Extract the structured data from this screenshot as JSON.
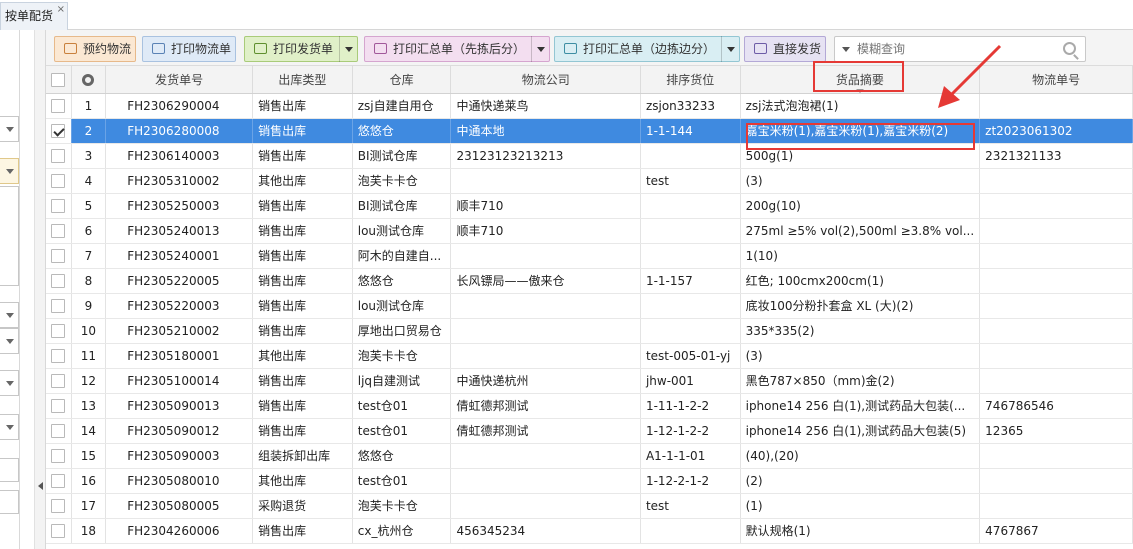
{
  "tab": {
    "label": "按单配货",
    "close": "×"
  },
  "toolbar": {
    "buttons": [
      {
        "label": "预约物流"
      },
      {
        "label": "打印物流单"
      },
      {
        "label": "打印发货单"
      },
      {
        "label": "打印汇总单（先拣后分）"
      },
      {
        "label": "打印汇总单（边拣边分）"
      },
      {
        "label": "直接发货"
      }
    ],
    "search_placeholder": "模糊查询"
  },
  "columns": [
    "发货单号",
    "出库类型",
    "仓库",
    "物流公司",
    "排序货位",
    "货品摘要",
    "物流单号"
  ],
  "rows": [
    {
      "n": "1",
      "checked": false,
      "no": "FH2306290004",
      "type": "销售出库",
      "wh": "zsj自建自用仓",
      "logi": "中通快递莱鸟",
      "loc": "zsjon33233",
      "sum": "zsj法式泡泡裙(1)",
      "track": ""
    },
    {
      "n": "2",
      "checked": true,
      "no": "FH2306280008",
      "type": "销售出库",
      "wh": "悠悠仓",
      "logi": "中通本地",
      "loc": "1-1-144",
      "sum": "嘉宝米粉(1),嘉宝米粉(1),嘉宝米粉(2)",
      "track": "zt2023061302"
    },
    {
      "n": "3",
      "checked": false,
      "no": "FH2306140003",
      "type": "销售出库",
      "wh": "BI测试仓库",
      "logi": "23123123213213",
      "loc": "",
      "sum": "500g(1)",
      "track": "2321321133"
    },
    {
      "n": "4",
      "checked": false,
      "no": "FH2305310002",
      "type": "其他出库",
      "wh": "泡芙卡卡仓",
      "logi": "",
      "loc": "test",
      "sum": "(3)",
      "track": ""
    },
    {
      "n": "5",
      "checked": false,
      "no": "FH2305250003",
      "type": "销售出库",
      "wh": "BI测试仓库",
      "logi": "顺丰710",
      "loc": "",
      "sum": "200g(10)",
      "track": ""
    },
    {
      "n": "6",
      "checked": false,
      "no": "FH2305240013",
      "type": "销售出库",
      "wh": "lou测试仓库",
      "logi": "顺丰710",
      "loc": "",
      "sum": "275ml ≥5% vol(2),500ml ≥3.8% vol...",
      "track": ""
    },
    {
      "n": "7",
      "checked": false,
      "no": "FH2305240001",
      "type": "销售出库",
      "wh": "阿木的自建自...",
      "logi": "",
      "loc": "",
      "sum": "1(10)",
      "track": ""
    },
    {
      "n": "8",
      "checked": false,
      "no": "FH2305220005",
      "type": "销售出库",
      "wh": "悠悠仓",
      "logi": "长风镖局——傲来仓",
      "loc": "1-1-157",
      "sum": "红色; 100cmx200cm(1)",
      "track": ""
    },
    {
      "n": "9",
      "checked": false,
      "no": "FH2305220003",
      "type": "销售出库",
      "wh": "lou测试仓库",
      "logi": "",
      "loc": "",
      "sum": "底妆100分粉扑套盒 XL (大)(2)",
      "track": ""
    },
    {
      "n": "10",
      "checked": false,
      "no": "FH2305210002",
      "type": "销售出库",
      "wh": "厚地出口贸易仓",
      "logi": "",
      "loc": "",
      "sum": "335*335(2)",
      "track": ""
    },
    {
      "n": "11",
      "checked": false,
      "no": "FH2305180001",
      "type": "其他出库",
      "wh": "泡芙卡卡仓",
      "logi": "",
      "loc": "test-005-01-yj",
      "sum": "(3)",
      "track": ""
    },
    {
      "n": "12",
      "checked": false,
      "no": "FH2305100014",
      "type": "销售出库",
      "wh": "ljq自建测试",
      "logi": "中通快递杭州",
      "loc": "jhw-001",
      "sum": "黑色787×850（mm)金(2)",
      "track": ""
    },
    {
      "n": "13",
      "checked": false,
      "no": "FH2305090013",
      "type": "销售出库",
      "wh": "test仓01",
      "logi": "倩虹德邦测试",
      "loc": "1-11-1-2-2",
      "sum": "iphone14 256 白(1),测试药品大包装(...",
      "track": "746786546"
    },
    {
      "n": "14",
      "checked": false,
      "no": "FH2305090012",
      "type": "销售出库",
      "wh": "test仓01",
      "logi": "倩虹德邦测试",
      "loc": "1-12-1-2-2",
      "sum": "iphone14 256 白(1),测试药品大包装(5)",
      "track": "12365"
    },
    {
      "n": "15",
      "checked": false,
      "no": "FH2305090003",
      "type": "组装拆卸出库",
      "wh": "悠悠仓",
      "logi": "",
      "loc": "A1-1-1-01",
      "sum": "(40),(20)",
      "track": ""
    },
    {
      "n": "16",
      "checked": false,
      "no": "FH2305080010",
      "type": "其他出库",
      "wh": "test仓01",
      "logi": "",
      "loc": "1-12-2-1-2",
      "sum": "(2)",
      "track": ""
    },
    {
      "n": "17",
      "checked": false,
      "no": "FH2305080005",
      "type": "采购退货",
      "wh": "泡芙卡卡仓",
      "logi": "",
      "loc": "test",
      "sum": "(1)",
      "track": ""
    },
    {
      "n": "18",
      "checked": false,
      "no": "FH2304260006",
      "type": "销售出库",
      "wh": "cx_杭州仓",
      "logi": "456345234",
      "loc": "",
      "sum": "默认规格(1)",
      "track": "4767867"
    }
  ],
  "colors": {
    "selected_row": "#3f8ae0",
    "highlight": "#e53935"
  }
}
